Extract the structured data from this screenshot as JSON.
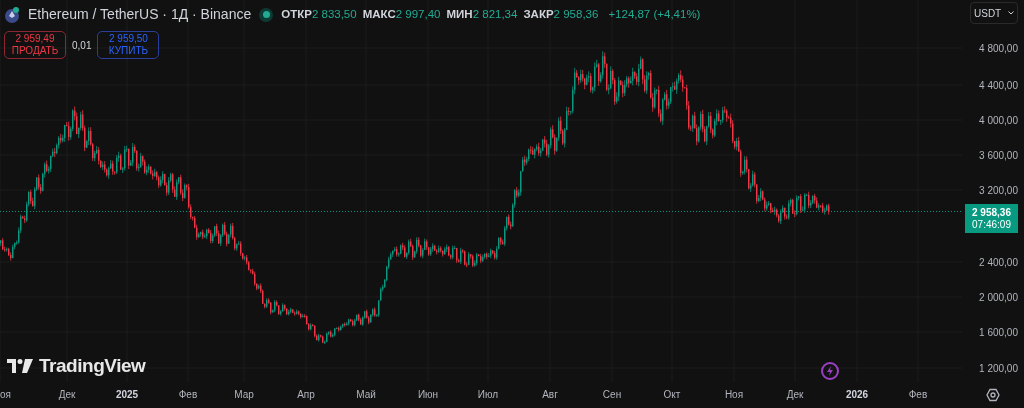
{
  "symbol": {
    "title": "Ethereum / TetherUS · 1Д · Binance",
    "market_open": true
  },
  "ohlc": [
    {
      "label": "ОТКР",
      "value": "2 833,50"
    },
    {
      "label": "МАКС",
      "value": "2 997,40"
    },
    {
      "label": "МИН",
      "value": "2 821,34"
    },
    {
      "label": "ЗАКР",
      "value": "2 958,36"
    }
  ],
  "change": "+124,87 (+4,41%)",
  "trade": {
    "sell_price": "2 959,49",
    "sell_label": "ПРОДАТЬ",
    "spread": "0,01",
    "buy_price": "2 959,50",
    "buy_label": "КУПИТЬ"
  },
  "currency": "USDT",
  "price_axis": [
    "4 800,00",
    "4 400,00",
    "4 000,00",
    "3 600,00",
    "3 200,00",
    "2 400,00",
    "2 000,00",
    "1 600,00",
    "1 200,00"
  ],
  "last_price": {
    "value": "2 958,36",
    "countdown": "07:46:09"
  },
  "logo": "TradingView",
  "time_axis": [
    {
      "label": "оя",
      "kind": "month"
    },
    {
      "label": "Дек",
      "kind": "month"
    },
    {
      "label": "2025",
      "kind": "year"
    },
    {
      "label": "Фев",
      "kind": "month"
    },
    {
      "label": "Мар",
      "kind": "month"
    },
    {
      "label": "Апр",
      "kind": "month"
    },
    {
      "label": "Май",
      "kind": "month"
    },
    {
      "label": "Июн",
      "kind": "month"
    },
    {
      "label": "Июл",
      "kind": "month"
    },
    {
      "label": "Авг",
      "kind": "month"
    },
    {
      "label": "Сен",
      "kind": "month"
    },
    {
      "label": "Окт",
      "kind": "month"
    },
    {
      "label": "Ноя",
      "kind": "month"
    },
    {
      "label": "Дек",
      "kind": "month"
    },
    {
      "label": "2026",
      "kind": "year"
    },
    {
      "label": "Фев",
      "kind": "month"
    }
  ]
}
